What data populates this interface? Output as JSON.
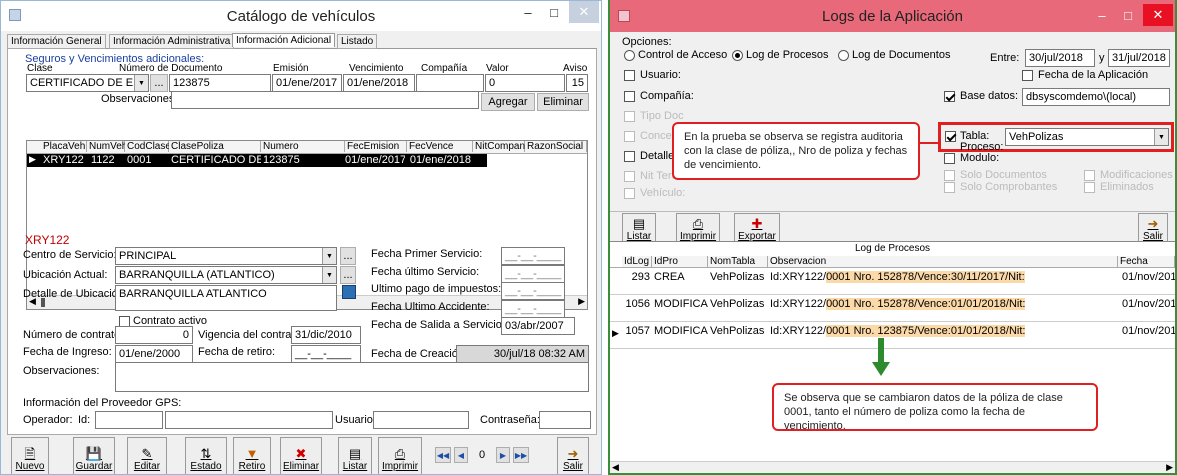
{
  "left": {
    "title": "Catálogo de vehículos",
    "tabs": [
      "Información General",
      "Información Administrativa",
      "Información Adicional",
      "Listado"
    ],
    "group_title": "Seguros y Vencimientos adicionales:",
    "form_headers": {
      "clase": "Clase",
      "numero": "Número de Documento",
      "emision": "Emisión",
      "vencimiento": "Vencimiento",
      "compania": "Compañía",
      "valor": "Valor",
      "aviso": "Aviso"
    },
    "form_values": {
      "clase": "CERTIFICADO DE EMISI(",
      "ellipsis": "...",
      "numero": "123875",
      "emision": "01/ene/2017",
      "vencimiento": "01/ene/2018",
      "compania": "",
      "valor": "0",
      "aviso": "15"
    },
    "observaciones_label": "Observaciones:",
    "agregar": "Agregar",
    "eliminar_btn": "Eliminar",
    "grid": {
      "headers": [
        "PlacaVeh",
        "NumVeh",
        "CodClase",
        "ClasePoliza",
        "Numero",
        "FecEmision",
        "FecVence",
        "NitCompania",
        "RazonSocial"
      ],
      "row": [
        "XRY122",
        "1122",
        "0001",
        "CERTIFICADO DE EN",
        "123875",
        "01/ene/2017",
        "01/ene/2018",
        "",
        ""
      ]
    },
    "plate": "XRY122",
    "details": {
      "centro_label": "Centro de Servicio:",
      "centro_value": "PRINCIPAL",
      "ubicacion_label": "Ubicación Actual:",
      "ubicacion_value": "BARRANQUILLA  (ATLANTICO)",
      "detalle_label": "Detalle de Ubicación:",
      "detalle_value": "BARRANQUILLA ATLANTICO",
      "contrato_activo": "Contrato activo",
      "num_contrato_label": "Número de contrato:",
      "num_contrato_value": "0",
      "vigencia_label": "Vigencia del contrato:",
      "vigencia_value": "31/dic/2010",
      "ingreso_label": "Fecha de Ingreso:",
      "ingreso_value": "01/ene/2000",
      "retiro_label": "Fecha de retiro:",
      "retiro_value": "__-__-____",
      "obs_label": "Observaciones:",
      "primer_servicio_label": "Fecha Primer Servicio:",
      "ultimo_servicio_label": "Fecha último Servicio:",
      "ultimo_pago_label": "Ultimo pago de impuestos:",
      "ultimo_accidente_label": "Fecha Ultimo Accidente:",
      "salida_label": "Fecha de Salida a Servicio:",
      "salida_value": "03/abr/2007",
      "creacion_label": "Fecha de Creación:",
      "creacion_value": "30/jul/18 08:32 AM",
      "empty_date": "__-__-____"
    },
    "gps": {
      "title": "Información del Proveedor GPS:",
      "operador": "Operador:",
      "id": "Id:",
      "usuario": "Usuario:",
      "contrasena": "Contraseña:"
    },
    "toolbar": [
      "Nuevo",
      "Guardar",
      "Editar",
      "Estado",
      "Retiro",
      "Eliminar",
      "Listar",
      "Imprimir",
      "Salir"
    ],
    "nav_value": "0"
  },
  "right": {
    "title": "Logs de la Aplicación",
    "opciones": "Opciones:",
    "radios": [
      "Control de Acceso",
      "Log de Procesos",
      "Log de Documentos"
    ],
    "entre": "Entre:",
    "date_from": "30/jul/2018",
    "y": "y",
    "date_to": "31/jul/2018",
    "usuario": "Usuario:",
    "compania": "Compañía:",
    "fecha_aplicacion": "Fecha de la Aplicación",
    "base_datos_label": "Base datos:",
    "base_datos_value": "dbsyscomdemo\\(local)",
    "tabla_label": "Tabla:",
    "tabla_value": "VehPolizas",
    "proceso": "Proceso:",
    "modulo": "Modulo:",
    "tipo_doc": "Tipo Doc",
    "concepto": "Concepto",
    "detalles": "Detalles:",
    "nit_tercero": "Nit Tercero:",
    "vehiculo": "Vehículo:",
    "solo_documentos": "Solo Documentos",
    "solo_comprobantes": "Solo Comprobantes",
    "modificaciones": "Modificaciones",
    "eliminados": "Eliminados",
    "toolbar": [
      "Listar",
      "Imprimir",
      "Exportar",
      "Salir"
    ],
    "log_title": "Log de Procesos",
    "log_headers": [
      "IdLog",
      "IdPro",
      "NomTabla",
      "Observacion",
      "Fecha"
    ],
    "log_rows": [
      {
        "idlog": "293",
        "idpro": "CREA",
        "tabla": "VehPolizas",
        "obs_pre": "Id:XRY122/",
        "obs_hl": "0001 Nro. 152878/Vence:30/11/2017/Nit:",
        "fecha": "01/nov/201"
      },
      {
        "idlog": "1056",
        "idpro": "MODIFICA",
        "tabla": "VehPolizas",
        "obs_pre": "Id:XRY122/",
        "obs_hl": "0001 Nro. 152878/Vence:01/01/2018/Nit:",
        "fecha": "01/nov/201"
      },
      {
        "idlog": "1057",
        "idpro": "MODIFICA",
        "tabla": "VehPolizas",
        "obs_pre": "Id:XRY122/",
        "obs_hl": "0001 Nro. 123875/Vence:01/01/2018/Nit:",
        "fecha": "01/nov/201"
      }
    ],
    "callout1": "En la prueba se observa se registra auditoria con la clase de póliza,, Nro de poliza  y fechas de vencimiento.",
    "callout2": "Se observa que se cambiaron datos de la póliza de clase 0001, tanto el número de poliza como la fecha de vencimiento."
  },
  "colors": {
    "left_border": "#9bb7d6",
    "right_border": "#3a8e3a",
    "right_title": "#e86a7a",
    "close": "#e81123",
    "callout_border": "#e02020",
    "highlight": "#fbd9a8"
  }
}
